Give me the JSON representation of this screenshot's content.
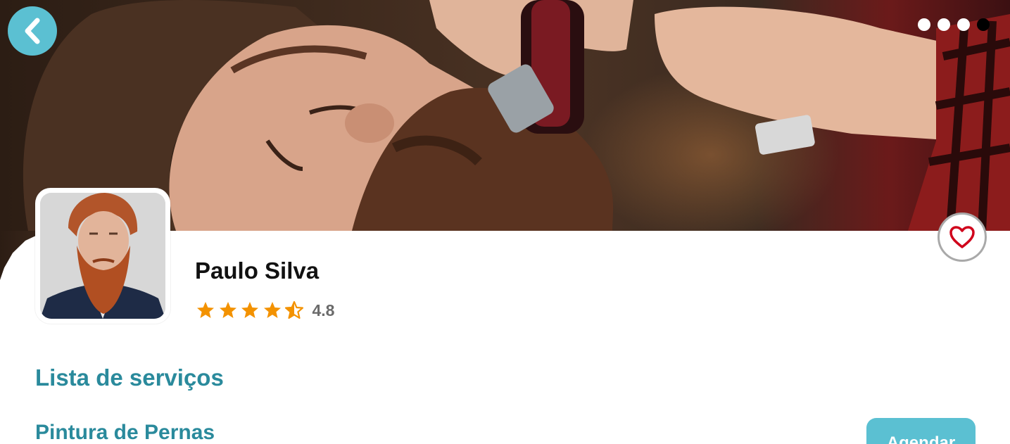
{
  "header": {
    "back_icon": "chevron-left-icon",
    "carousel": {
      "count": 4,
      "active_index": 3
    }
  },
  "colors": {
    "accent": "#5bc0d2",
    "title_teal": "#2a8a9c",
    "star": "#f39200",
    "heart": "#d0021b"
  },
  "profile": {
    "name": "Paulo Silva",
    "rating": 4.8,
    "rating_text": "4.8",
    "favorite_icon": "heart-outline-icon"
  },
  "services": {
    "title": "Lista de serviços",
    "items": [
      {
        "name": "Pintura de Pernas",
        "action_label": "Agendar"
      }
    ]
  }
}
